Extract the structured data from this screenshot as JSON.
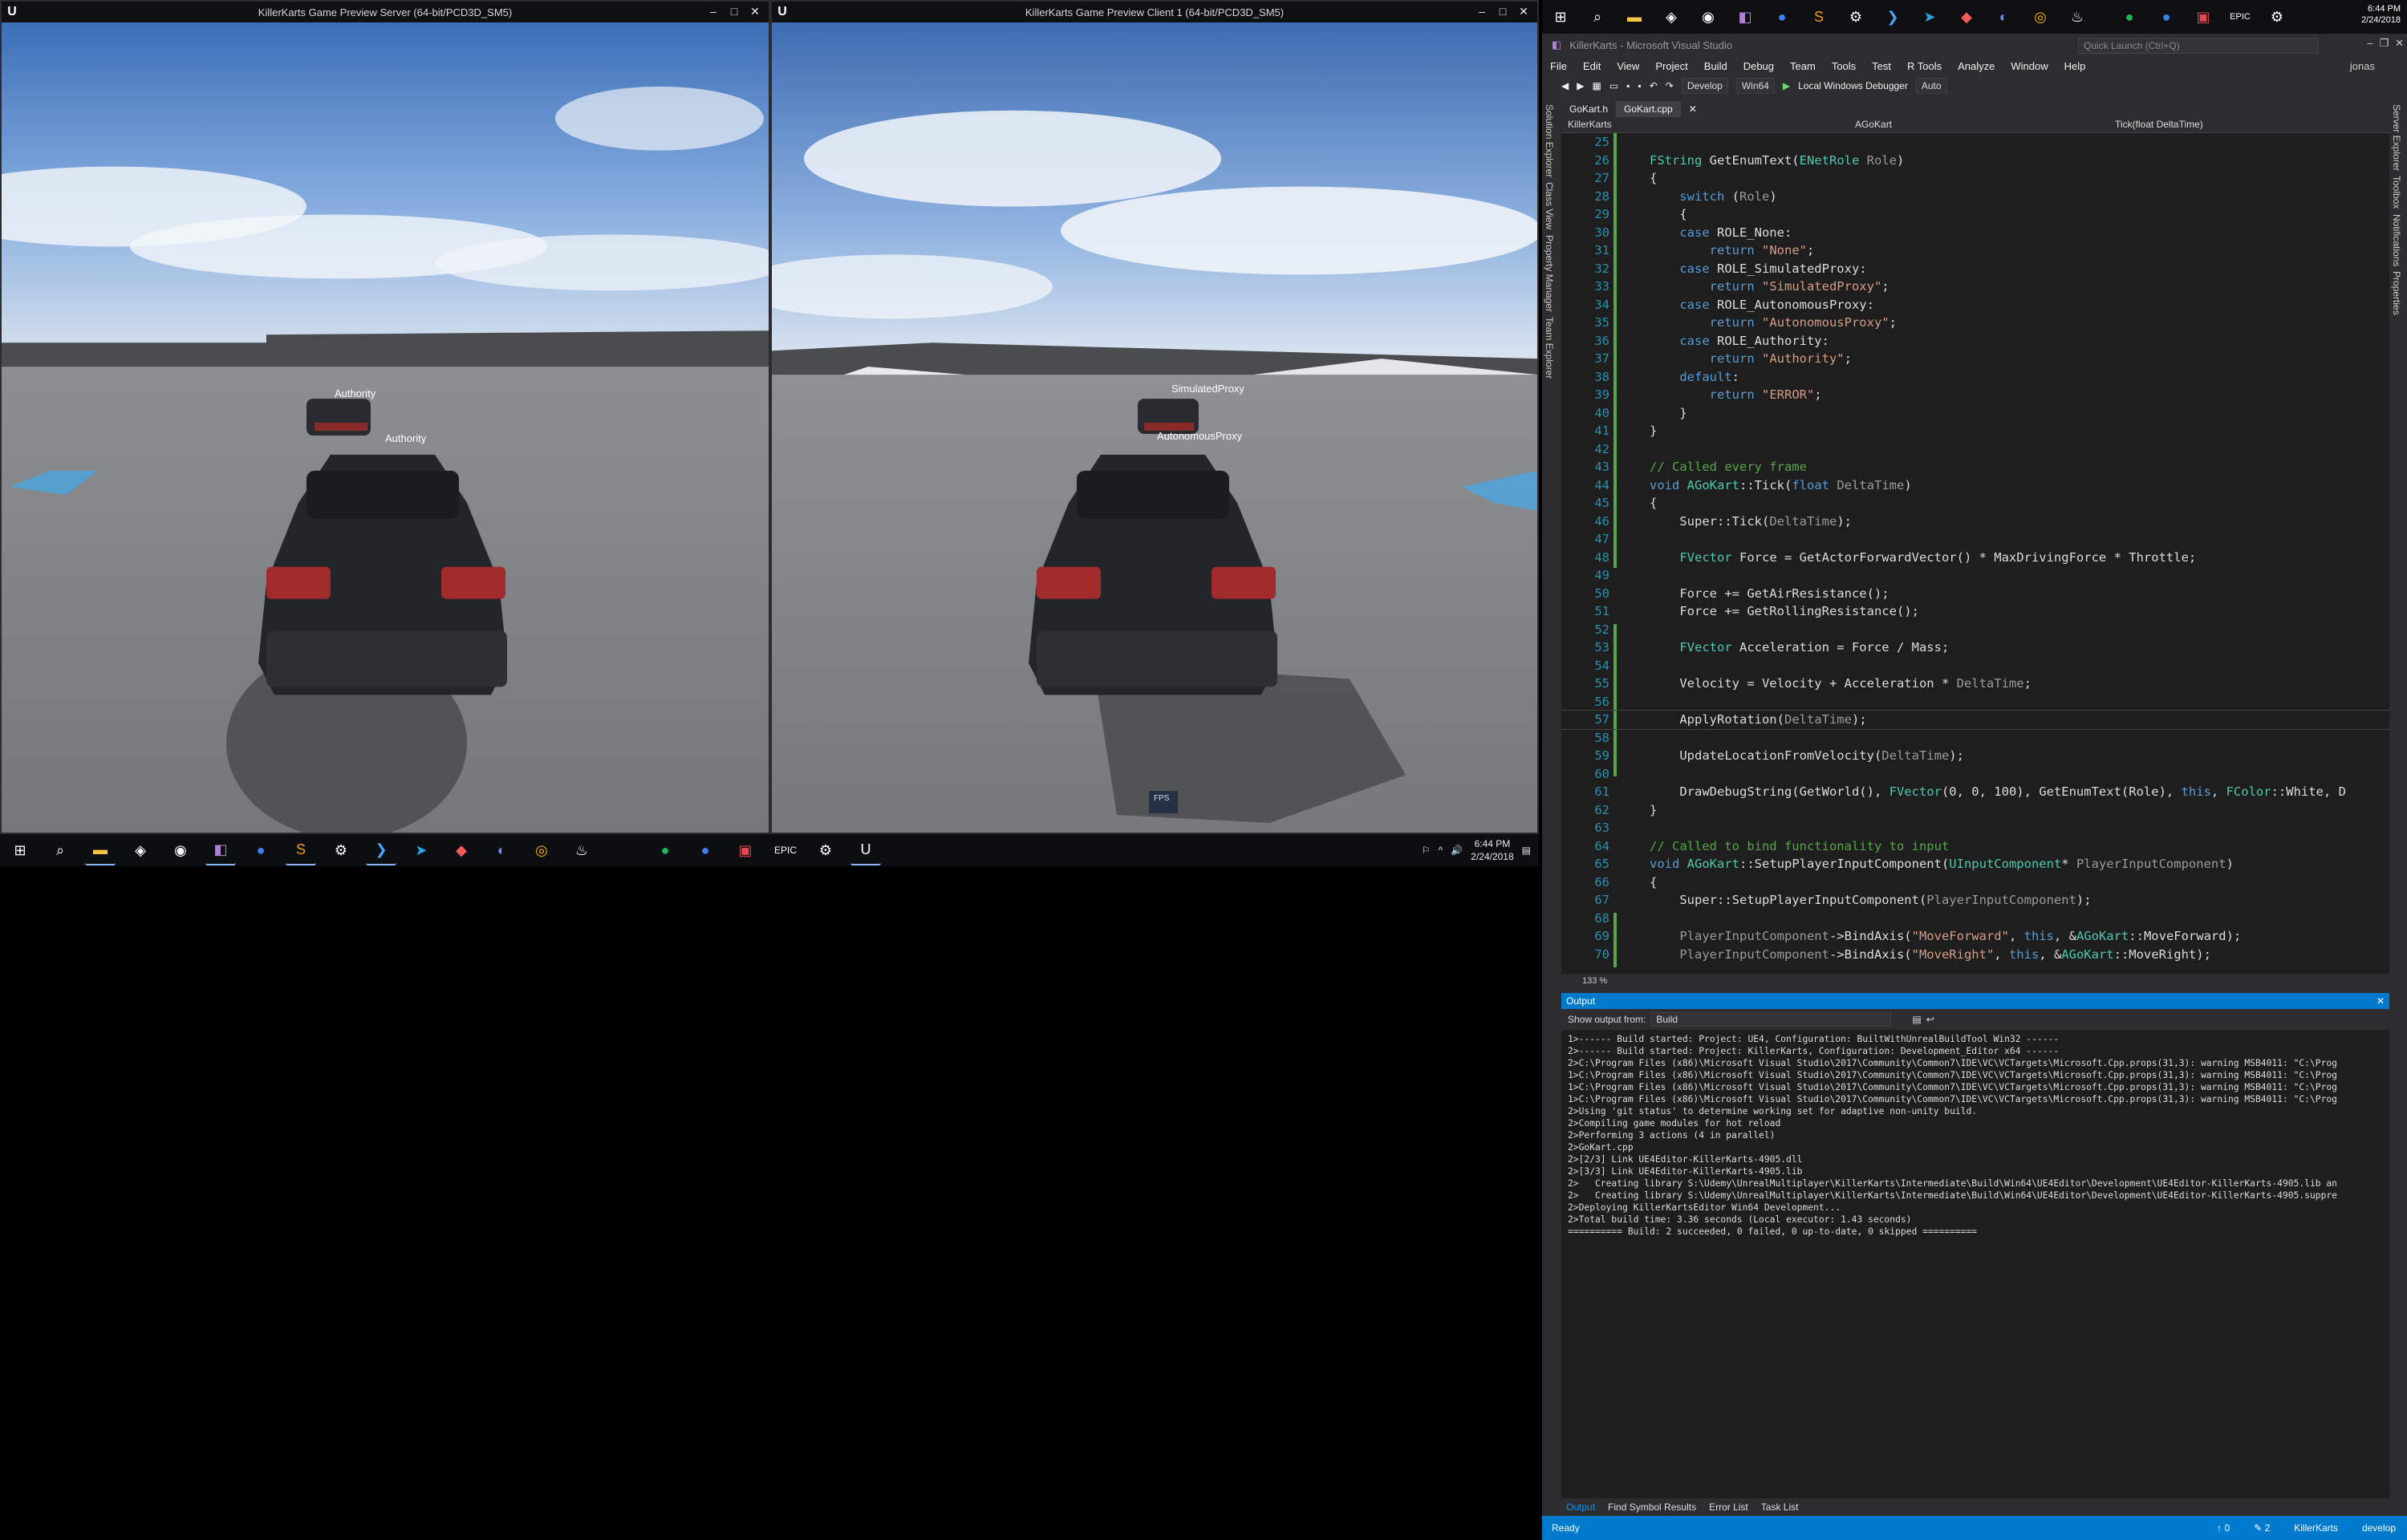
{
  "server_window": {
    "title": "KillerKarts Game Preview Server (64-bit/PCD3D_SM5)",
    "label_far": "Authority",
    "label_near": "Authority"
  },
  "client_window": {
    "title": "KillerKarts Game Preview Client 1 (64-bit/PCD3D_SM5)",
    "label_far": "SimulatedProxy",
    "label_near": "AutonomousProxy",
    "fps_label": "FPS"
  },
  "taskbar": {
    "time": "6:44 PM",
    "date": "2/24/2018"
  },
  "vs": {
    "title": "KillerKarts - Microsoft Visual Studio",
    "quick_launch": "Quick Launch (Ctrl+Q)",
    "user": "jonas",
    "clock_time": "6:44 PM",
    "clock_date": "2/24/2018",
    "menu": [
      "File",
      "Edit",
      "View",
      "Project",
      "Build",
      "Debug",
      "Team",
      "Tools",
      "Test",
      "R Tools",
      "Analyze",
      "Window",
      "Help"
    ],
    "toolbar": {
      "config": "Develop",
      "platform": "Win64",
      "debugger": "Local Windows Debugger",
      "auto": "Auto"
    },
    "left_tabs": [
      "Solution Explorer",
      "Class View",
      "Property Manager",
      "Team Explorer"
    ],
    "right_tabs": [
      "Server Explorer",
      "Toolbox",
      "Notifications",
      "Properties"
    ],
    "doc_tabs": [
      "GoKart.h",
      "GoKart.cpp"
    ],
    "nav": {
      "project": "KillerKarts",
      "scope": "AGoKart",
      "member": "Tick(float DeltaTime)"
    },
    "zoom": "133 %",
    "output": {
      "title": "Output",
      "show_from_label": "Show output from:",
      "show_from_value": "Build",
      "lines": [
        "1>------ Build started: Project: UE4, Configuration: BuiltWithUnrealBuildTool Win32 ------",
        "2>------ Build started: Project: KillerKarts, Configuration: Development_Editor x64 ------",
        "2>C:\\Program Files (x86)\\Microsoft Visual Studio\\2017\\Community\\Common7\\IDE\\VC\\VCTargets\\Microsoft.Cpp.props(31,3): warning MSB4011: \"C:\\Prog",
        "1>C:\\Program Files (x86)\\Microsoft Visual Studio\\2017\\Community\\Common7\\IDE\\VC\\VCTargets\\Microsoft.Cpp.props(31,3): warning MSB4011: \"C:\\Prog",
        "1>C:\\Program Files (x86)\\Microsoft Visual Studio\\2017\\Community\\Common7\\IDE\\VC\\VCTargets\\Microsoft.Cpp.props(31,3): warning MSB4011: \"C:\\Prog",
        "1>C:\\Program Files (x86)\\Microsoft Visual Studio\\2017\\Community\\Common7\\IDE\\VC\\VCTargets\\Microsoft.Cpp.props(31,3): warning MSB4011: \"C:\\Prog",
        "2>Using 'git status' to determine working set for adaptive non-unity build.",
        "2>Compiling game modules for hot reload",
        "2>Performing 3 actions (4 in parallel)",
        "2>GoKart.cpp",
        "2>[2/3] Link UE4Editor-KillerKarts-4905.dll",
        "2>[3/3] Link UE4Editor-KillerKarts-4905.lib",
        "2>   Creating library S:\\Udemy\\UnrealMultiplayer\\KillerKarts\\Intermediate\\Build\\Win64\\UE4Editor\\Development\\UE4Editor-KillerKarts-4905.lib an",
        "2>   Creating library S:\\Udemy\\UnrealMultiplayer\\KillerKarts\\Intermediate\\Build\\Win64\\UE4Editor\\Development\\UE4Editor-KillerKarts-4905.suppre",
        "2>Deploying KillerKartsEditor Win64 Development...",
        "2>Total build time: 3.36 seconds (Local executor: 1.43 seconds)",
        "========== Build: 2 succeeded, 0 failed, 0 up-to-date, 0 skipped =========="
      ],
      "tabs": [
        "Output",
        "Find Symbol Results",
        "Error List",
        "Task List"
      ]
    },
    "status": {
      "ready": "Ready",
      "up": "0",
      "edits": "2",
      "project": "KillerKarts",
      "branch": "develop"
    },
    "code": [
      {
        "n": "25",
        "t": []
      },
      {
        "n": "26",
        "t": [
          [
            "ty",
            "FString"
          ],
          [
            "fn",
            " GetEnumText("
          ],
          [
            "ty",
            "ENetRole"
          ],
          [
            "pm",
            " Role"
          ],
          [
            "fn",
            ")"
          ]
        ]
      },
      {
        "n": "27",
        "t": [
          [
            "fn",
            "{"
          ]
        ]
      },
      {
        "n": "28",
        "t": [
          [
            "kw",
            "    switch"
          ],
          [
            "fn",
            " ("
          ],
          [
            "pm",
            "Role"
          ],
          [
            "fn",
            ")"
          ]
        ]
      },
      {
        "n": "29",
        "t": [
          [
            "fn",
            "    {"
          ]
        ]
      },
      {
        "n": "30",
        "t": [
          [
            "kw",
            "    case"
          ],
          [
            "fn",
            " ROLE_None:"
          ]
        ]
      },
      {
        "n": "31",
        "t": [
          [
            "kw",
            "        return"
          ],
          [
            "st",
            " \"None\""
          ],
          [
            "fn",
            ";"
          ]
        ]
      },
      {
        "n": "32",
        "t": [
          [
            "kw",
            "    case"
          ],
          [
            "fn",
            " ROLE_SimulatedProxy:"
          ]
        ]
      },
      {
        "n": "33",
        "t": [
          [
            "kw",
            "        return"
          ],
          [
            "st",
            " \"SimulatedProxy\""
          ],
          [
            "fn",
            ";"
          ]
        ]
      },
      {
        "n": "34",
        "t": [
          [
            "kw",
            "    case"
          ],
          [
            "fn",
            " ROLE_AutonomousProxy:"
          ]
        ]
      },
      {
        "n": "35",
        "t": [
          [
            "kw",
            "        return"
          ],
          [
            "st",
            " \"AutonomousProxy\""
          ],
          [
            "fn",
            ";"
          ]
        ]
      },
      {
        "n": "36",
        "t": [
          [
            "kw",
            "    case"
          ],
          [
            "fn",
            " ROLE_Authority:"
          ]
        ]
      },
      {
        "n": "37",
        "t": [
          [
            "kw",
            "        return"
          ],
          [
            "st",
            " \"Authority\""
          ],
          [
            "fn",
            ";"
          ]
        ]
      },
      {
        "n": "38",
        "t": [
          [
            "kw",
            "    default"
          ],
          [
            "fn",
            ":"
          ]
        ]
      },
      {
        "n": "39",
        "t": [
          [
            "kw",
            "        return"
          ],
          [
            "st",
            " \"ERROR\""
          ],
          [
            "fn",
            ";"
          ]
        ]
      },
      {
        "n": "40",
        "t": [
          [
            "fn",
            "    }"
          ]
        ]
      },
      {
        "n": "41",
        "t": [
          [
            "fn",
            "}"
          ]
        ]
      },
      {
        "n": "42",
        "t": []
      },
      {
        "n": "43",
        "t": [
          [
            "cm",
            "// Called every frame"
          ]
        ]
      },
      {
        "n": "44",
        "t": [
          [
            "kw",
            "void"
          ],
          [
            "fn",
            " "
          ],
          [
            "ty",
            "AGoKart"
          ],
          [
            "fn",
            "::Tick("
          ],
          [
            "kw",
            "float"
          ],
          [
            "pm",
            " DeltaTime"
          ],
          [
            "fn",
            ")"
          ]
        ]
      },
      {
        "n": "45",
        "t": [
          [
            "fn",
            "{"
          ]
        ]
      },
      {
        "n": "46",
        "t": [
          [
            "fn",
            "    Super::Tick("
          ],
          [
            "pm",
            "DeltaTime"
          ],
          [
            "fn",
            ");"
          ]
        ]
      },
      {
        "n": "47",
        "t": []
      },
      {
        "n": "48",
        "t": [
          [
            "ty",
            "    FVector"
          ],
          [
            "fn",
            " Force = GetActorForwardVector() * MaxDrivingForce * Throttle;"
          ]
        ]
      },
      {
        "n": "49",
        "t": []
      },
      {
        "n": "50",
        "t": [
          [
            "fn",
            "    Force += GetAirResistance();"
          ]
        ]
      },
      {
        "n": "51",
        "t": [
          [
            "fn",
            "    Force += GetRollingResistance();"
          ]
        ]
      },
      {
        "n": "52",
        "t": []
      },
      {
        "n": "53",
        "t": [
          [
            "ty",
            "    FVector"
          ],
          [
            "fn",
            " Acceleration = Force / Mass;"
          ]
        ]
      },
      {
        "n": "54",
        "t": []
      },
      {
        "n": "55",
        "t": [
          [
            "fn",
            "    Velocity = Velocity + Acceleration * "
          ],
          [
            "pm",
            "DeltaTime"
          ],
          [
            "fn",
            ";"
          ]
        ]
      },
      {
        "n": "56",
        "t": []
      },
      {
        "n": "57",
        "t": [
          [
            "fn",
            "    ApplyRotation("
          ],
          [
            "pm",
            "DeltaTime"
          ],
          [
            "fn",
            ");"
          ]
        ]
      },
      {
        "n": "58",
        "t": []
      },
      {
        "n": "59",
        "t": [
          [
            "fn",
            "    UpdateLocationFromVelocity("
          ],
          [
            "pm",
            "DeltaTime"
          ],
          [
            "fn",
            ");"
          ]
        ]
      },
      {
        "n": "60",
        "t": []
      },
      {
        "n": "61",
        "t": [
          [
            "fn",
            "    DrawDebugString(GetWorld(), "
          ],
          [
            "ty",
            "FVector"
          ],
          [
            "fn",
            "(0, 0, 100), GetEnumText(Role), "
          ],
          [
            "kw",
            "this"
          ],
          [
            "fn",
            ", "
          ],
          [
            "ty",
            "FColor"
          ],
          [
            "fn",
            "::White, D"
          ]
        ]
      },
      {
        "n": "62",
        "t": [
          [
            "fn",
            "}"
          ]
        ]
      },
      {
        "n": "63",
        "t": []
      },
      {
        "n": "64",
        "t": [
          [
            "cm",
            "// Called to bind functionality to input"
          ]
        ]
      },
      {
        "n": "65",
        "t": [
          [
            "kw",
            "void"
          ],
          [
            "fn",
            " "
          ],
          [
            "ty",
            "AGoKart"
          ],
          [
            "fn",
            "::SetupPlayerInputComponent("
          ],
          [
            "ty",
            "UInputComponent"
          ],
          [
            "fn",
            "* "
          ],
          [
            "pm",
            "PlayerInputComponent"
          ],
          [
            "fn",
            ")"
          ]
        ]
      },
      {
        "n": "66",
        "t": [
          [
            "fn",
            "{"
          ]
        ]
      },
      {
        "n": "67",
        "t": [
          [
            "fn",
            "    Super::SetupPlayerInputComponent("
          ],
          [
            "pm",
            "PlayerInputComponent"
          ],
          [
            "fn",
            ");"
          ]
        ]
      },
      {
        "n": "68",
        "t": []
      },
      {
        "n": "69",
        "t": [
          [
            "pm",
            "    PlayerInputComponent"
          ],
          [
            "fn",
            "->BindAxis("
          ],
          [
            "st",
            "\"MoveForward\""
          ],
          [
            "fn",
            ", "
          ],
          [
            "kw",
            "this"
          ],
          [
            "fn",
            ", &"
          ],
          [
            "ty",
            "AGoKart"
          ],
          [
            "fn",
            "::MoveForward);"
          ]
        ]
      },
      {
        "n": "70",
        "t": [
          [
            "pm",
            "    PlayerInputComponent"
          ],
          [
            "fn",
            "->BindAxis("
          ],
          [
            "st",
            "\"MoveRight\""
          ],
          [
            "fn",
            ", "
          ],
          [
            "kw",
            "this"
          ],
          [
            "fn",
            ", &"
          ],
          [
            "ty",
            "AGoKart"
          ],
          [
            "fn",
            "::MoveRight);"
          ]
        ]
      }
    ]
  }
}
